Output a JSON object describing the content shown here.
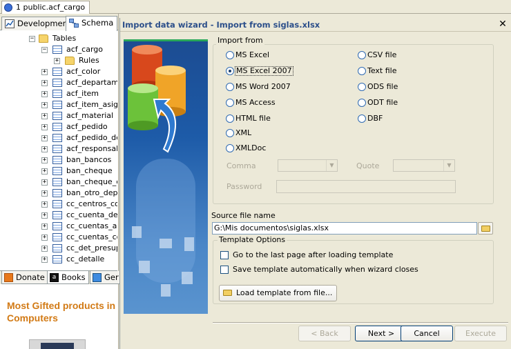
{
  "doc_tab": {
    "label": "1 public.acf_cargo"
  },
  "left_tabs": [
    {
      "label": "Development",
      "active": false
    },
    {
      "label": "Schema",
      "active": true
    }
  ],
  "tree": {
    "tables_label": "Tables",
    "rules_label": "Rules",
    "items": [
      "acf_cargo",
      "acf_color",
      "acf_departamer",
      "acf_item",
      "acf_item_asigna",
      "acf_material",
      "acf_pedido",
      "acf_pedido_det",
      "acf_responsable",
      "ban_bancos",
      "ban_cheque",
      "ban_cheque_de",
      "ban_otro_depos",
      "cc_centros_cos",
      "cc_cuenta_dep",
      "cc_cuentas_au",
      "cc_cuentas_co",
      "cc_det_presup",
      "cc_detalle"
    ]
  },
  "bottom_tabs": [
    {
      "label": "Donate",
      "active": false
    },
    {
      "label": "Books",
      "active": true
    },
    {
      "label": "Ger",
      "active": false
    }
  ],
  "promo": {
    "text": "Most Gifted products in Computers"
  },
  "dialog": {
    "title": "Import data wizard - Import from siglas.xlsx",
    "close": "✕",
    "import_from": {
      "label": "Import from",
      "left_options": [
        "MS Excel",
        "MS Excel 2007",
        "MS Word 2007",
        "MS Access",
        "HTML file",
        "XML",
        "XMLDoc"
      ],
      "right_options": [
        "CSV file",
        "Text file",
        "ODS file",
        "ODT file",
        "DBF"
      ],
      "selected": "MS Excel 2007",
      "comma_label": "Comma",
      "quote_label": "Quote",
      "password_label": "Password"
    },
    "source": {
      "label": "Source file name",
      "value": "G:\\Mis documentos\\siglas.xlsx"
    },
    "template": {
      "label": "Template Options",
      "check1": "Go to the last page after loading template",
      "check2": "Save template automatically when wizard closes",
      "load_button": "Load template from file..."
    },
    "buttons": {
      "back": "< Back",
      "next": "Next >",
      "cancel": "Cancel",
      "execute": "Execute"
    }
  },
  "colors": {
    "title_text": "#2c4f8a",
    "promo_text": "#d27a15",
    "banner_blue": "#1d5ba8"
  }
}
